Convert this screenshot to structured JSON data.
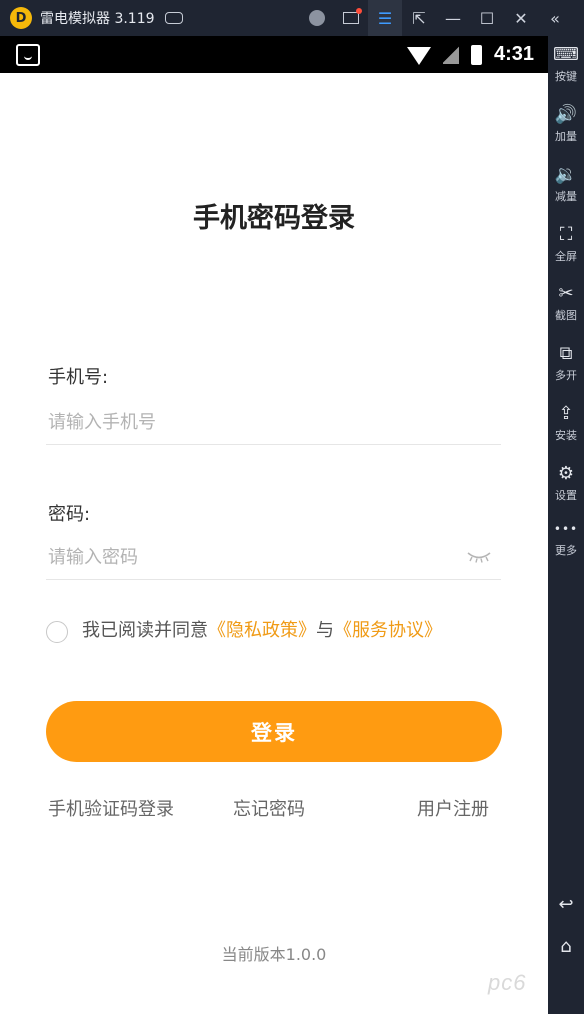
{
  "emulator": {
    "title": "雷电模拟器 3.119",
    "logo_text": "D",
    "icons": [
      "gamepad-icon",
      "user-icon",
      "mail-icon",
      "menu-icon",
      "popout-icon",
      "minimize-icon",
      "maximize-icon",
      "close-icon",
      "collapse-icon"
    ],
    "sidebar": {
      "items": [
        {
          "label": "按键",
          "icon": "keyboard-icon",
          "glyph": "⌨"
        },
        {
          "label": "加量",
          "icon": "volume-up-icon",
          "glyph": "🔊"
        },
        {
          "label": "减量",
          "icon": "volume-down-icon",
          "glyph": "🔉"
        },
        {
          "label": "全屏",
          "icon": "fullscreen-icon",
          "glyph": "⛶"
        },
        {
          "label": "截图",
          "icon": "scissors-icon",
          "glyph": "✂"
        },
        {
          "label": "多开",
          "icon": "multi-open-icon",
          "glyph": "⧉"
        },
        {
          "label": "安装",
          "icon": "apk-install-icon",
          "glyph": "⇪"
        },
        {
          "label": "设置",
          "icon": "gear-icon",
          "glyph": "⚙"
        },
        {
          "label": "更多",
          "icon": "more-icon",
          "glyph": "•••"
        }
      ],
      "nav": [
        {
          "icon": "back-icon",
          "glyph": "↩"
        },
        {
          "icon": "home-icon",
          "glyph": "⌂"
        }
      ]
    }
  },
  "statusbar": {
    "time": "4:31"
  },
  "login": {
    "title": "手机密码登录",
    "phone_label": "手机号:",
    "phone_placeholder": "请输入手机号",
    "phone_value": "",
    "password_label": "密码:",
    "password_placeholder": "请输入密码",
    "password_value": "",
    "agree_prefix": "我已阅读并同意",
    "privacy_link": "《隐私政策》",
    "agree_and": "与",
    "service_link": "《服务协议》",
    "agree_checked": false,
    "login_button": "登录",
    "sms_login_link": "手机验证码登录",
    "forgot_password_link": "忘记密码",
    "register_link": "用户注册",
    "version": "当前版本1.0.0"
  },
  "watermark": "pc6",
  "colors": {
    "accent": "#ff9b11",
    "link": "#f09b16",
    "emulator_bg": "#1f2532"
  }
}
